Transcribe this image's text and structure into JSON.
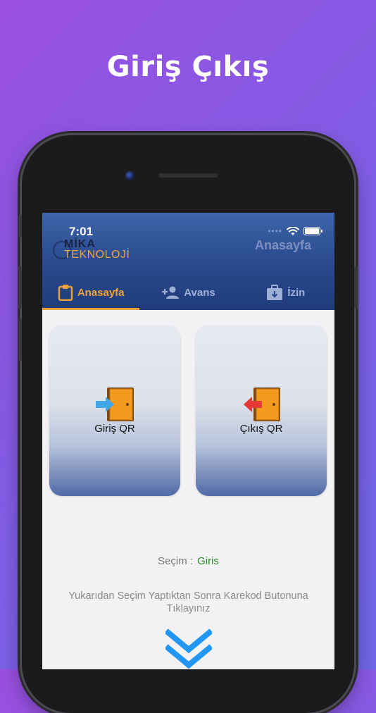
{
  "headline": "Giriş Çıkış",
  "status_bar": {
    "time": "7:01"
  },
  "header": {
    "logo_line1": "MİKA",
    "logo_line2": "TEKNOLOJİ",
    "page_title": "Anasayfa"
  },
  "tabs": [
    {
      "label": "Anasayfa",
      "icon": "clipboard-icon",
      "active": true
    },
    {
      "label": "Avans",
      "icon": "add-person-icon",
      "active": false
    },
    {
      "label": "İzin",
      "icon": "briefcase-icon",
      "active": false
    }
  ],
  "cards": {
    "checkin": {
      "label": "Giriş QR",
      "icon": "door-enter-icon",
      "arrow_color": "#3fa7e8"
    },
    "checkout": {
      "label": "Çıkış QR",
      "icon": "door-exit-icon",
      "arrow_color": "#e53935"
    }
  },
  "selection": {
    "label": "Seçim :",
    "value": "Giris"
  },
  "instruction": "Yukarıdan Seçim Yaptıktan Sonra Karekod Butonuna Tıklayınız",
  "colors": {
    "accent": "#f0a23a",
    "header_blue": "#2c4d91",
    "chevron_blue": "#2196f3",
    "selection_green": "#2d8a2d"
  }
}
